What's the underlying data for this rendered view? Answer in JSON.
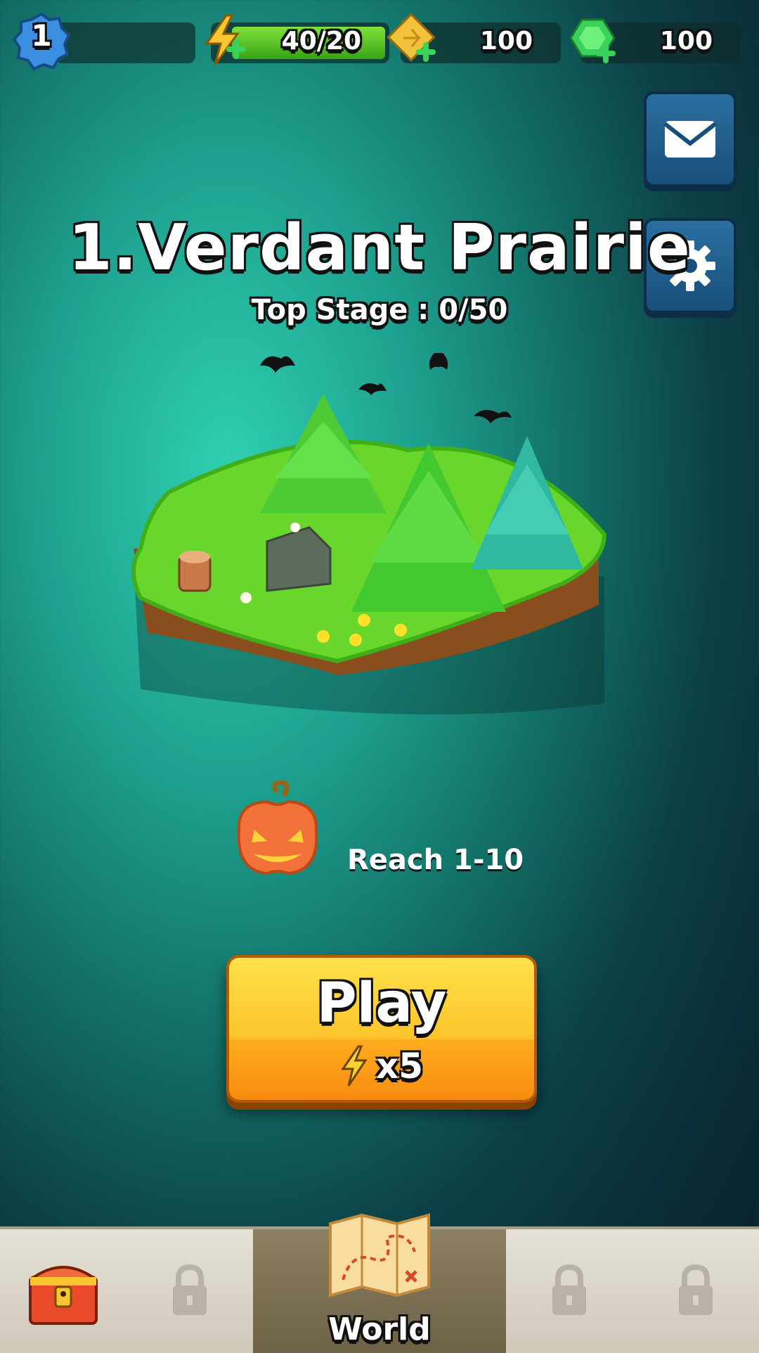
{
  "hud": {
    "level": "1",
    "energy": "40/20",
    "coins": "100",
    "gems": "100",
    "colors": {
      "energy_fill": "#5cc52a",
      "level_badge": "#3b8fe0",
      "gem": "#3ad25a",
      "coin": "#f3c23c"
    }
  },
  "side_buttons": {
    "mail_icon": "envelope-icon",
    "settings_icon": "gear-icon"
  },
  "world": {
    "title": "1.Verdant Prairie",
    "top_stage": "Top Stage : 0/50"
  },
  "reward": {
    "icon": "pumpkin-icon",
    "text": "Reach 1-10"
  },
  "play": {
    "label": "Play",
    "cost": "x5",
    "cost_icon": "lightning-icon"
  },
  "nav": {
    "items": [
      {
        "icon": "treasure-chest-icon",
        "label": "",
        "locked": false
      },
      {
        "icon": "lock-icon",
        "label": "",
        "locked": true
      },
      {
        "icon": "map-icon",
        "label": "World",
        "locked": false,
        "active": true
      },
      {
        "icon": "lock-icon",
        "label": "",
        "locked": true
      },
      {
        "icon": "lock-icon",
        "label": "",
        "locked": true
      }
    ]
  }
}
